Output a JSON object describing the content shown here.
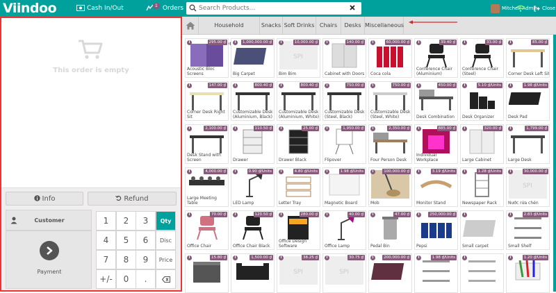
{
  "topbar": {
    "logo": "Viindoo",
    "cash_label": "Cash In/Out",
    "orders_label": "Orders",
    "orders_badge": "1",
    "search_placeholder": "Search Products...",
    "user_name": "Mitchell Admin",
    "close_label": "Close",
    "bg_color": "#00a09d"
  },
  "order": {
    "empty_text": "This order is empty"
  },
  "controls": {
    "info_label": "Info",
    "refund_label": "Refund",
    "customer_label": "Customer",
    "payment_label": "Payment"
  },
  "numpad": {
    "rows": [
      [
        "1",
        "2",
        "3",
        "Qty"
      ],
      [
        "4",
        "5",
        "6",
        "Disc"
      ],
      [
        "7",
        "8",
        "9",
        "Price"
      ],
      [
        "+/-",
        "0",
        ".",
        ""
      ]
    ],
    "active_mode": "Qty"
  },
  "categories": [
    "Household equipment",
    "Snacks",
    "Soft Drinks",
    "Chairs",
    "Desks",
    "Miscellaneous"
  ],
  "products": [
    {
      "name": "Acoustic Bloc Screens",
      "price": "295.00 ₫",
      "icon": "screen-panel",
      "color": "#6a4c9c"
    },
    {
      "name": "Big Carpet",
      "price": "1,000,000.00 ₫",
      "icon": "carpet",
      "color": "#4a5078"
    },
    {
      "name": "Bim Bim",
      "price": "10,000.00 ₫",
      "icon": "placeholder",
      "color": "#eeeeee"
    },
    {
      "name": "Cabinet with Doors",
      "price": "140.00 ₫",
      "icon": "cabinet",
      "color": "#dddddd"
    },
    {
      "name": "Coca cola",
      "price": "60,000.00 ₫",
      "icon": "bottles",
      "color": "#c8102e"
    },
    {
      "name": "Conference Chair (Aluminium)",
      "price": "39.40 ₫",
      "icon": "chair",
      "color": "#222222"
    },
    {
      "name": "Conference Chair (Steel)",
      "price": "33.00 ₫",
      "icon": "chair",
      "color": "#222222"
    },
    {
      "name": "Corner Desk Left Sit",
      "price": "85.00 ₫",
      "icon": "desk",
      "color": "#e0c890"
    },
    {
      "name": "Corner Desk Right Sit",
      "price": "147.00 ₫",
      "icon": "desk",
      "color": "#e8e0b0"
    },
    {
      "name": "Customizable Desk (Aluminium, Black)",
      "price": "800.40 ₫",
      "icon": "desk",
      "color": "#333333"
    },
    {
      "name": "Customizable Desk (Aluminium, White)",
      "price": "800.40 ₫",
      "icon": "desk",
      "color": "#333333"
    },
    {
      "name": "Customizable Desk (Steel, Black)",
      "price": "750.00 ₫",
      "icon": "desk",
      "color": "#333333"
    },
    {
      "name": "Customizable Desk (Steel, White)",
      "price": "750.00 ₫",
      "icon": "desk",
      "color": "#cccccc"
    },
    {
      "name": "Desk Combination",
      "price": "450.00 ₫",
      "icon": "desk-combo",
      "color": "#555555"
    },
    {
      "name": "Desk Organizer",
      "price": "5.10 ₫/Units",
      "icon": "organizer",
      "color": "#222222"
    },
    {
      "name": "Desk Pad",
      "price": "1.98 ₫/Units",
      "icon": "pad",
      "color": "#222222"
    },
    {
      "name": "Desk Stand with Screen",
      "price": "2,100.00 ₫",
      "icon": "desk",
      "color": "#333333"
    },
    {
      "name": "Drawer",
      "price": "110.50 ₫",
      "icon": "drawer",
      "color": "#eeeeee"
    },
    {
      "name": "Drawer Black",
      "price": "25.00 ₫",
      "icon": "drawer",
      "color": "#222222"
    },
    {
      "name": "Flipover",
      "price": "1,950.00 ₫",
      "icon": "flipchart",
      "color": "#dddddd"
    },
    {
      "name": "Four Person Desk",
      "price": "2,350.00 ₫",
      "icon": "desk-combo",
      "color": "#a08060"
    },
    {
      "name": "Individual Workplace",
      "price": "885.00 ₫",
      "icon": "booth",
      "color": "#b0105a"
    },
    {
      "name": "Large Cabinet",
      "price": "320.00 ₫",
      "icon": "cabinet",
      "color": "#eeeeee"
    },
    {
      "name": "Large Desk",
      "price": "1,799.00 ₫",
      "icon": "desk",
      "color": "#444444"
    },
    {
      "name": "Large Meeting Table",
      "price": "4,000.00 ₫",
      "icon": "table",
      "color": "#333333"
    },
    {
      "name": "LED Lamp",
      "price": "0.90 ₫/Units",
      "icon": "lamp",
      "color": "#333333"
    },
    {
      "name": "Letter Tray",
      "price": "4.80 ₫/Units",
      "icon": "tray",
      "color": "#b08050"
    },
    {
      "name": "Magnetic Board",
      "price": "1.98 ₫/Units",
      "icon": "board",
      "color": "#eeeeee"
    },
    {
      "name": "Mob",
      "price": "100,000.00 ₫",
      "icon": "mop",
      "color": "#b09060"
    },
    {
      "name": "Monitor Stand",
      "price": "3.19 ₫/Units",
      "icon": "stand",
      "color": "#c8a070"
    },
    {
      "name": "Newspaper Rack",
      "price": "1.28 ₫/Units",
      "icon": "rack",
      "color": "#888888"
    },
    {
      "name": "Nước rửa chén",
      "price": "30,000.00 ₫",
      "icon": "placeholder",
      "color": "#eeeeee"
    },
    {
      "name": "Office Chair",
      "price": "70.00 ₫",
      "icon": "chair",
      "color": "#d07080"
    },
    {
      "name": "Office Chair Black",
      "price": "120.50 ₫",
      "icon": "chair",
      "color": "#222222"
    },
    {
      "name": "Office Design Software",
      "price": "280.00 ₫",
      "icon": "software-box",
      "color": "#222222"
    },
    {
      "name": "Office Lamp",
      "price": "40.00 ₫",
      "icon": "lamp",
      "color": "#a01080"
    },
    {
      "name": "Pedal Bin",
      "price": "47.00 ₫",
      "icon": "bin",
      "color": "#aaaaaa"
    },
    {
      "name": "Pepsi",
      "price": "250,000.00 ₫",
      "icon": "cans",
      "color": "#1a3a8a"
    },
    {
      "name": "Small carpet",
      "price": "",
      "icon": "carpet",
      "color": "#cccccc"
    },
    {
      "name": "Small Shelf",
      "price": "2.83 ₫/Units",
      "icon": "shelf",
      "color": "#888888"
    },
    {
      "name": "",
      "price": "15.80 ₫",
      "icon": "box",
      "color": "#555555"
    },
    {
      "name": "",
      "price": "1,500.00 ₫",
      "icon": "sofa",
      "color": "#222222"
    },
    {
      "name": "",
      "price": "38.25 ₫",
      "icon": "placeholder",
      "color": "#eeeeee"
    },
    {
      "name": "",
      "price": "30.75 ₫",
      "icon": "placeholder",
      "color": "#eeeeee"
    },
    {
      "name": "",
      "price": "200,000.00 ₫",
      "icon": "carpet",
      "color": "#603040"
    },
    {
      "name": "",
      "price": "1.98 ₫/Units",
      "icon": "shelf",
      "color": "#999999"
    },
    {
      "name": "",
      "price": "",
      "icon": "shelf",
      "color": "#aaaaaa"
    },
    {
      "name": "",
      "price": "1.20 ₫/Units",
      "icon": "markers",
      "color": "#3a9a3a"
    }
  ]
}
